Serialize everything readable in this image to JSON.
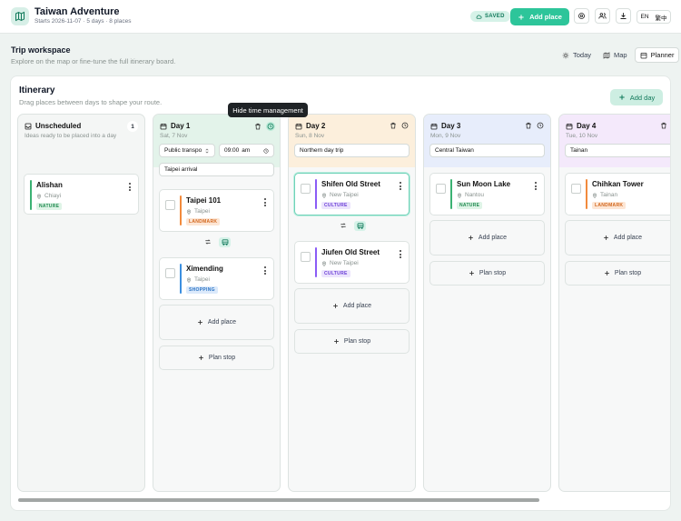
{
  "app": {
    "title": "Taiwan Adventure",
    "subtitle": "Starts 2026-11-07 · 5 days · 8 places",
    "status": "SAVED",
    "add_place_label": "Add place",
    "lang_en": "EN",
    "lang_zh": "繁中"
  },
  "workspace": {
    "title": "Trip workspace",
    "subtitle": "Explore on the map or fine-tune the full itinerary board.",
    "views": [
      "Today",
      "Map",
      "Planner"
    ],
    "active_view": "Planner"
  },
  "itinerary": {
    "title": "Itinerary",
    "subtitle": "Drag places between days to shape your route.",
    "add_day_label": "Add day",
    "add_place_slot": "Add place",
    "plan_stop_slot": "Plan stop",
    "tooltip": "Hide time management"
  },
  "unscheduled": {
    "title": "Unscheduled",
    "subtitle": "Ideas ready to be placed into a day",
    "count": "1",
    "cards": [
      {
        "name": "Alishan",
        "location": "Chiayi",
        "category": "NATURE"
      }
    ]
  },
  "days": [
    {
      "title": "Day 1",
      "date": "Sat, 7 Nov",
      "transport": "Public transpo",
      "time": "09:00",
      "ampm": "am",
      "note": "Taipei arrival",
      "cards": [
        {
          "name": "Taipei 101",
          "location": "Taipei",
          "category": "LANDMARK"
        },
        {
          "name": "Ximending",
          "location": "Taipei",
          "category": "SHOPPING"
        }
      ]
    },
    {
      "title": "Day 2",
      "date": "Sun, 8 Nov",
      "note": "Northern day trip",
      "cards": [
        {
          "name": "Shifen Old Street",
          "location": "New Taipei",
          "category": "CULTURE"
        },
        {
          "name": "Jiufen Old Street",
          "location": "New Taipei",
          "category": "CULTURE"
        }
      ]
    },
    {
      "title": "Day 3",
      "date": "Mon, 9 Nov",
      "note": "Central Taiwan",
      "cards": [
        {
          "name": "Sun Moon Lake",
          "location": "Nantou",
          "category": "NATURE"
        }
      ]
    },
    {
      "title": "Day 4",
      "date": "Tue, 10 Nov",
      "note": "Tainan",
      "cards": [
        {
          "name": "Chihkan Tower",
          "location": "Tainan",
          "category": "LANDMARK"
        }
      ]
    }
  ],
  "colors": {
    "accent": "#2dc59a",
    "nature": "#3bb273",
    "landmark": "#f28a3c",
    "shopping": "#3b8fe0",
    "culture": "#8b5cf6"
  },
  "icons": [
    "map-icon",
    "cloud-icon",
    "plus-icon",
    "settings-icon",
    "users-icon",
    "download-icon",
    "sun-icon",
    "map-view-icon",
    "planner-icon",
    "calendar-icon",
    "trash-icon",
    "clock-icon",
    "pin-icon",
    "shuffle-icon",
    "bus-icon",
    "dots-icon"
  ]
}
